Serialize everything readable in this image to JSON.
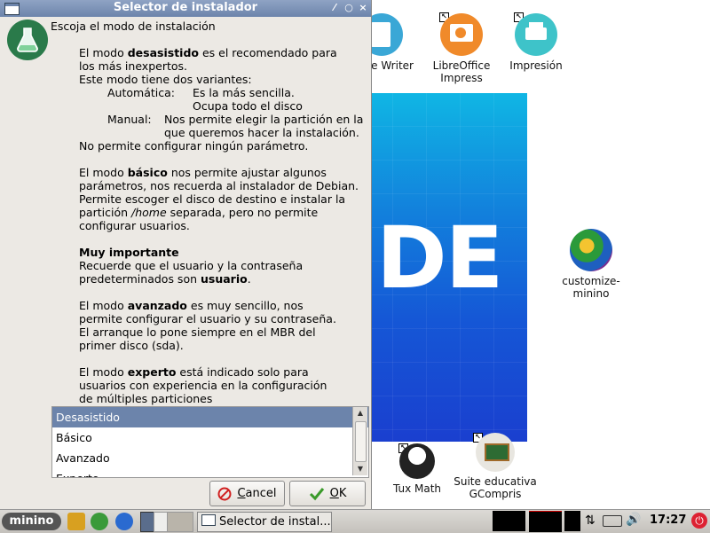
{
  "dialog": {
    "title": "Selector de instalador",
    "header": "Escoja el modo de instalación",
    "desasistido": {
      "pre": "El modo ",
      "bold": "desasistido",
      "post1": " es el recomendado para",
      "post2": "los más inexpertos.",
      "line3": "Este modo tiene dos variantes:",
      "auto_label": "Automática:",
      "auto_1": "Es la más sencilla.",
      "auto_2": "Ocupa todo el disco",
      "manual_label": "Manual:",
      "manual_1": "Nos permite elegir la partición en la",
      "manual_2": "que queremos hacer la instalación.",
      "line_last": "No permite configurar ningún parámetro."
    },
    "basico": {
      "pre": "El modo ",
      "bold": "básico",
      "post": " nos permite ajustar algunos",
      "l2": "parámetros, nos recuerda al instalador de Debian.",
      "l3": "Permite escoger el disco de destino e instalar la",
      "l4_pre": "partición ",
      "l4_italic": "/home",
      "l4_post": " separada, pero no permite",
      "l5": "configurar usuarios."
    },
    "importante": {
      "title": "Muy importante",
      "l1": "Recuerde que el usuario y la contraseña",
      "l2_pre": "predeterminados son ",
      "l2_bold": "usuario",
      "l2_post": "."
    },
    "avanzado": {
      "pre": "El modo ",
      "bold": "avanzado",
      "post": " es muy sencillo, nos",
      "l2": "permite configurar el usuario y su contraseña.",
      "l3": "El arranque lo pone siempre en el MBR del",
      "l4": "primer disco (sda)."
    },
    "experto": {
      "pre": "El modo ",
      "bold": "experto",
      "post": " está indicado solo para",
      "l2": "usuarios con experiencia en la configuración",
      "l3": "de múltiples particiones"
    },
    "list": {
      "items": [
        "Desasistido",
        "Básico",
        "Avanzado",
        "Experto"
      ],
      "selected": "Desasistido"
    },
    "cancel_first": "C",
    "cancel_rest": "ancel",
    "ok_first": "O",
    "ok_rest": "K"
  },
  "desktop": {
    "icons": {
      "writer": "fice Writer",
      "impress_1": "LibreOffice",
      "impress_2": "Impress",
      "impresion": "Impresión",
      "customize_1": "customize-",
      "customize_2": "minino",
      "tuxmath": "Tux Math",
      "gcompris_1": "Suite educativa",
      "gcompris_2": "GCompris"
    },
    "wallpaper_text": "DE"
  },
  "taskbar": {
    "start_label": "minino",
    "task_label": "Selector de instal...",
    "clock": "17:27"
  }
}
